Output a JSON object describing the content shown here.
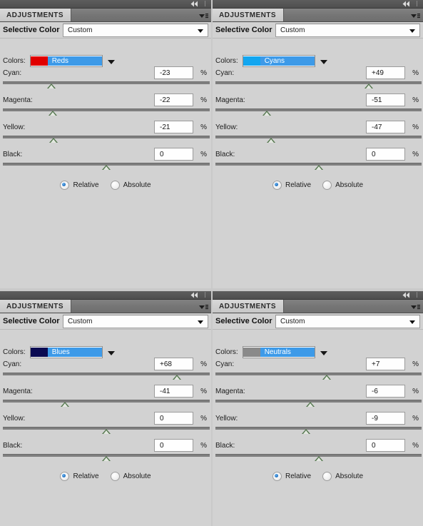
{
  "app": {
    "panel_tab_label": "ADJUSTMENTS",
    "title_label": "Selective Color",
    "preset_value": "Custom",
    "colors_label": "Colors:",
    "percent_symbol": "%",
    "collapse_icon": "collapse-to-icons-double-arrow",
    "menu_icon": "panel-menu-icon",
    "caret_icon": "chevron-down-icon",
    "relative_label": "Relative",
    "absolute_label": "Absolute",
    "accent_highlight": "#3d9ae8",
    "panel_bg": "#d2d2d2",
    "tab_bg": "#d4d4d4",
    "slider_thumb": "#55774f"
  },
  "panels": [
    {
      "id": "panel-reds",
      "tab_label": "ADJUSTMENTS",
      "title": "Selective Color",
      "preset": "Custom",
      "color_channel": "Reds",
      "swatch_color": "#e00000",
      "method": "Relative",
      "sliders": [
        {
          "label": "Cyan:",
          "value": "-23",
          "pct": 23.5
        },
        {
          "label": "Magenta:",
          "value": "-22",
          "pct": 24.0
        },
        {
          "label": "Yellow:",
          "value": "-21",
          "pct": 24.5
        },
        {
          "label": "Black:",
          "value": "0",
          "pct": 50.0
        }
      ]
    },
    {
      "id": "panel-cyans",
      "tab_label": "ADJUSTMENTS",
      "title": "Selective Color",
      "preset": "Custom",
      "color_channel": "Cyans",
      "swatch_color": "#12a6f0",
      "method": "Relative",
      "sliders": [
        {
          "label": "Cyan:",
          "value": "+49",
          "pct": 74.5
        },
        {
          "label": "Magenta:",
          "value": "-51",
          "pct": 25.0
        },
        {
          "label": "Yellow:",
          "value": "-47",
          "pct": 27.0
        },
        {
          "label": "Black:",
          "value": "0",
          "pct": 50.0
        }
      ]
    },
    {
      "id": "panel-blues",
      "tab_label": "ADJUSTMENTS",
      "title": "Selective Color",
      "preset": "Custom",
      "color_channel": "Blues",
      "swatch_color": "#0b0b52",
      "method": "Relative",
      "sliders": [
        {
          "label": "Cyan:",
          "value": "+68",
          "pct": 84.0
        },
        {
          "label": "Magenta:",
          "value": "-41",
          "pct": 30.0
        },
        {
          "label": "Yellow:",
          "value": "0",
          "pct": 50.0
        },
        {
          "label": "Black:",
          "value": "0",
          "pct": 50.0
        }
      ]
    },
    {
      "id": "panel-neutrals",
      "tab_label": "ADJUSTMENTS",
      "title": "Selective Color",
      "preset": "Custom",
      "color_channel": "Neutrals",
      "swatch_color": "#8a8a8a",
      "method": "Relative",
      "sliders": [
        {
          "label": "Cyan:",
          "value": "+7",
          "pct": 54.0
        },
        {
          "label": "Magenta:",
          "value": "-6",
          "pct": 46.0
        },
        {
          "label": "Yellow:",
          "value": "-9",
          "pct": 44.0
        },
        {
          "label": "Black:",
          "value": "0",
          "pct": 50.0
        }
      ]
    }
  ]
}
